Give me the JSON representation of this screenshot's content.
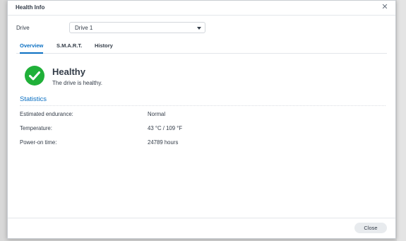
{
  "dialog": {
    "title": "Health Info",
    "close_icon": "close-icon"
  },
  "drive": {
    "label": "Drive",
    "selected": "Drive 1"
  },
  "tabs": [
    {
      "label": "Overview",
      "active": true
    },
    {
      "label": "S.M.A.R.T.",
      "active": false
    },
    {
      "label": "History",
      "active": false
    }
  ],
  "status": {
    "icon": "check-circle-icon",
    "title": "Healthy",
    "description": "The drive is healthy.",
    "color": "#20b039"
  },
  "statistics": {
    "title": "Statistics",
    "rows": [
      {
        "label": "Estimated endurance:",
        "value": "Normal"
      },
      {
        "label": "Temperature:",
        "value": "43 °C / 109 °F"
      },
      {
        "label": "Power-on time:",
        "value": "24789 hours"
      }
    ]
  },
  "footer": {
    "close_label": "Close"
  },
  "colors": {
    "accent": "#0a6fc2",
    "healthy": "#20b039"
  }
}
